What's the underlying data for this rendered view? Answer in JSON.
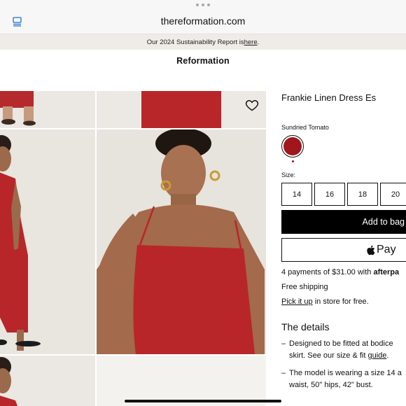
{
  "browser": {
    "url": "thereformation.com"
  },
  "announcement": {
    "text": "Our 2024 Sustainability Report is ",
    "link": "here",
    "suffix": "."
  },
  "brand": "Reformation",
  "product": {
    "title": "Frankie Linen Dress Es",
    "color_label": "Sundried Tomato",
    "swatch_color": "#a1161d",
    "size_label": "Size:",
    "sizes": [
      "14",
      "16",
      "18",
      "20"
    ],
    "add_to_bag": "Add to bag",
    "apple_pay": "Pay",
    "installments": "4 payments of $31.00 with ",
    "afterpay": "afterpa",
    "shipping": "Free shipping",
    "pickup_link": "Pick it up",
    "pickup_rest": " in store for free."
  },
  "details": {
    "heading": "The details",
    "b1_line1": "Designed to be fitted at bodice",
    "b1_line2_pre": "skirt. See our size & fit ",
    "b1_link": "guide",
    "b1_line2_post": ".",
    "b2_line1": "The model is wearing a size 14 a",
    "b2_line2": "waist, 50\" hips, 42\" bust."
  },
  "dress_color": "#b8262a"
}
